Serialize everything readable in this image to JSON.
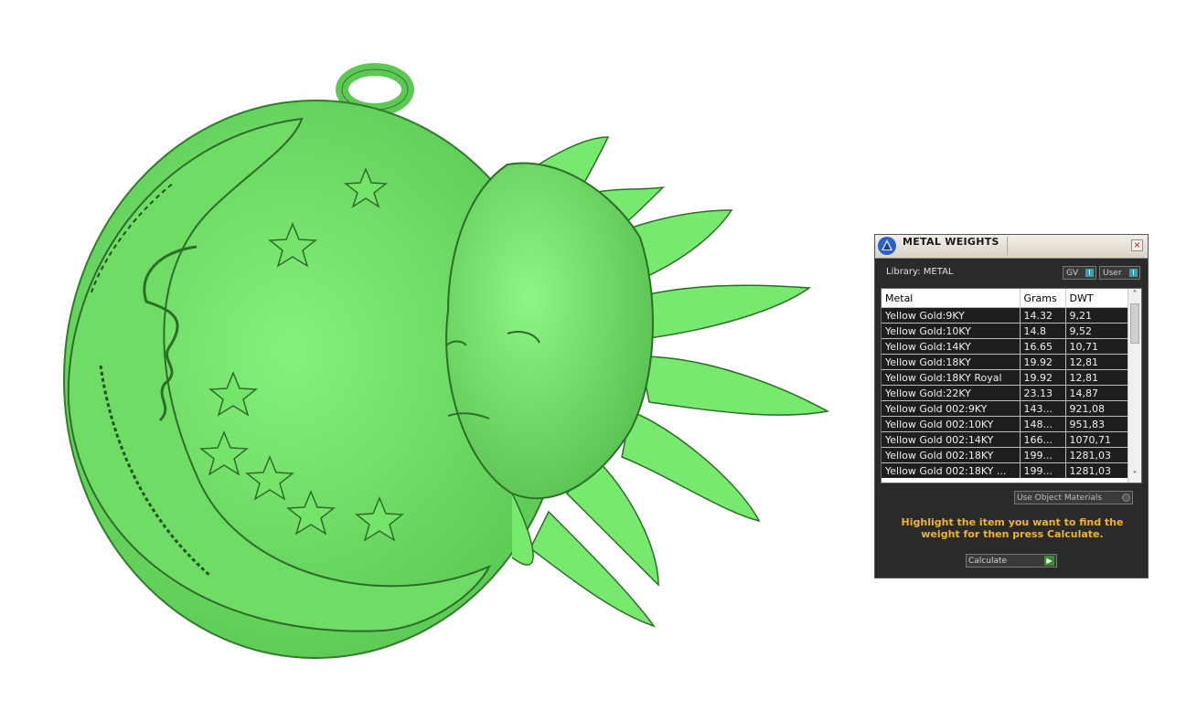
{
  "panel": {
    "title": "METAL WEIGHTS",
    "close_glyph": "×",
    "library_label": "Library: METAL",
    "gv_label": "GV",
    "user_label": "User",
    "toggle_glyph": "I",
    "columns": [
      "Metal",
      "Grams",
      "DWT"
    ],
    "rows": [
      [
        "Yellow Gold:9KY",
        "14.32",
        "9,21"
      ],
      [
        "Yellow Gold:10KY",
        "14.8",
        "9,52"
      ],
      [
        "Yellow Gold:14KY",
        "16.65",
        "10,71"
      ],
      [
        "Yellow Gold:18KY",
        "19.92",
        "12,81"
      ],
      [
        "Yellow Gold:18KY Royal",
        "19.92",
        "12,81"
      ],
      [
        "Yellow Gold:22KY",
        "23.13",
        "14,87"
      ],
      [
        "Yellow Gold 002:9KY",
        "143...",
        "921,08"
      ],
      [
        "Yellow Gold 002:10KY",
        "148...",
        "951,83"
      ],
      [
        "Yellow Gold 002:14KY",
        "166...",
        "1070,71"
      ],
      [
        "Yellow Gold 002:18KY",
        "199...",
        "1281,03"
      ],
      [
        "Yellow Gold 002:18KY ...",
        "199...",
        "1281,03"
      ]
    ],
    "use_object_materials": "Use Object Materials",
    "hint": "Highlight the item you want to find the weight for then press Calculate.",
    "calculate_label": "Calculate",
    "scroll_up": "˄",
    "scroll_down": "˅"
  },
  "colors": {
    "model_green": "#7bea72",
    "model_shadow": "#3fa73a",
    "panel_bg": "#2a2a2a",
    "hint_text": "#f0b428"
  }
}
